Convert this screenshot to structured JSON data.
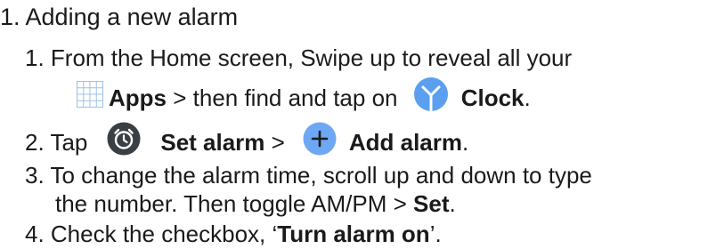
{
  "heading_partial": "...",
  "section_title": "1. Adding a new alarm",
  "steps": [
    {
      "line1": "1. From the Home screen, Swipe up to reveal all your",
      "line2": {
        "apps_label": "Apps",
        "text1": " > then find and tap on ",
        "clock_label": "Clock",
        "end": "."
      }
    },
    {
      "prefix": "2. Tap",
      "set_alarm_label": "Set alarm",
      "sep": " >",
      "add_alarm_label": "Add alarm",
      "end": "."
    },
    {
      "line1": "3. To change the alarm time, scroll up and down to type",
      "line2_text": "the number. Then toggle AM/PM > ",
      "set_label": "Set",
      "end": "."
    },
    {
      "prefix": "4. Check the checkbox, ‘",
      "turn_on_label": "Turn alarm on",
      "end": "’."
    }
  ],
  "icons": {
    "apps": "apps-grid-icon",
    "clock": "clock-app-icon",
    "set_alarm": "alarm-clock-icon",
    "add_alarm": "add-plus-icon"
  },
  "colors": {
    "text": "#1a1a1a",
    "clock_blue": "#5a9ff0",
    "alarm_dark": "#3a3f44",
    "add_blue": "#6ea8f4",
    "grid_blue": "#9dc1e6"
  }
}
